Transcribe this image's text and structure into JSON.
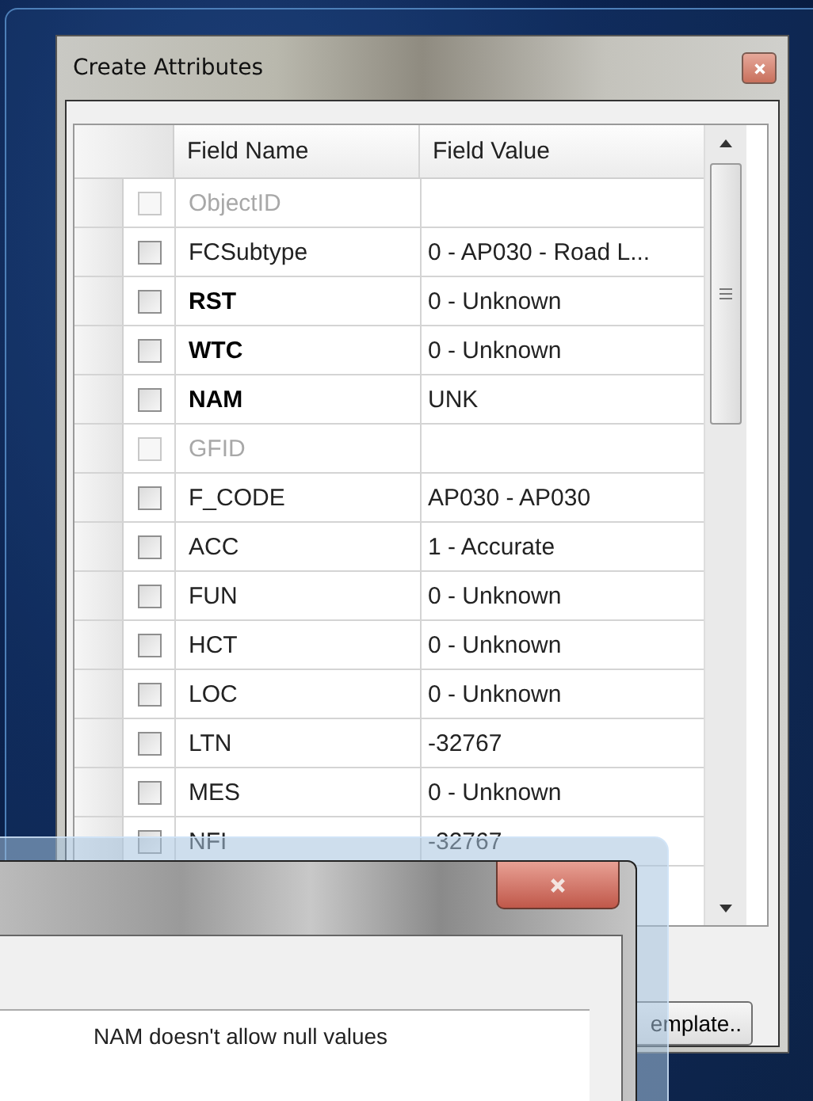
{
  "dialog": {
    "title": "Create Attributes",
    "columns": [
      "Field Name",
      "Field Value"
    ],
    "rows": [
      {
        "name": "ObjectID",
        "disabled": true,
        "required": false,
        "checked": false
      },
      {
        "name": "FCSubtype",
        "value": "0 - AP030 - Road L...",
        "disabled": false,
        "required": false,
        "checked": false
      },
      {
        "name": "RST",
        "value": "0 - Unknown",
        "disabled": false,
        "required": true,
        "checked": false
      },
      {
        "name": "WTC",
        "value": "0 - Unknown",
        "disabled": false,
        "required": true,
        "checked": false
      },
      {
        "name": "NAM",
        "value": "UNK",
        "disabled": false,
        "required": true,
        "checked": false
      },
      {
        "name": "GFID",
        "disabled": true,
        "required": false,
        "checked": false
      },
      {
        "name": "F_CODE",
        "value": "AP030 - AP030",
        "disabled": false,
        "required": false,
        "checked": false
      },
      {
        "name": "ACC",
        "value": "1 - Accurate",
        "disabled": false,
        "required": false,
        "checked": false
      },
      {
        "name": "FUN",
        "value": "0 - Unknown",
        "disabled": false,
        "required": false,
        "checked": false
      },
      {
        "name": "HCT",
        "value": "0 - Unknown",
        "disabled": false,
        "required": false,
        "checked": false
      },
      {
        "name": "LOC",
        "value": "0 - Unknown",
        "disabled": false,
        "required": false,
        "checked": false
      },
      {
        "name": "LTN",
        "value": "-32767",
        "disabled": false,
        "required": false,
        "checked": false
      },
      {
        "name": "MES",
        "value": "0 - Unknown",
        "disabled": false,
        "required": false,
        "checked": false
      },
      {
        "name": "NFI",
        "value": "-32767",
        "disabled": false,
        "required": false,
        "checked": false
      }
    ],
    "button": "emplate.."
  },
  "error_dialog": {
    "message": "NAM doesn't allow null values"
  }
}
